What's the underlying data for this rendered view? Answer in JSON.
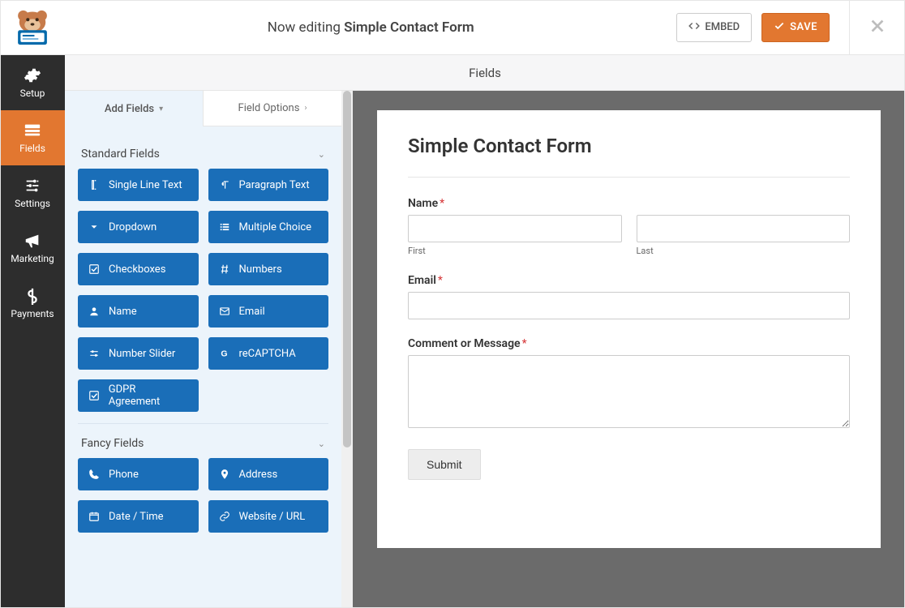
{
  "header": {
    "now_editing": "Now editing",
    "form_name": "Simple Contact Form",
    "embed": "EMBED",
    "save": "SAVE"
  },
  "sidebar": {
    "items": [
      {
        "id": "setup",
        "label": "Setup"
      },
      {
        "id": "fields",
        "label": "Fields"
      },
      {
        "id": "settings",
        "label": "Settings"
      },
      {
        "id": "marketing",
        "label": "Marketing"
      },
      {
        "id": "payments",
        "label": "Payments"
      }
    ]
  },
  "section_title": "Fields",
  "palette": {
    "tab_add": "Add Fields",
    "tab_options": "Field Options",
    "groups": [
      {
        "title": "Standard Fields",
        "fields": [
          {
            "id": "single-line-text",
            "label": "Single Line Text",
            "icon": "text-cursor"
          },
          {
            "id": "paragraph-text",
            "label": "Paragraph Text",
            "icon": "paragraph"
          },
          {
            "id": "dropdown",
            "label": "Dropdown",
            "icon": "caret-down"
          },
          {
            "id": "multiple-choice",
            "label": "Multiple Choice",
            "icon": "list"
          },
          {
            "id": "checkboxes",
            "label": "Checkboxes",
            "icon": "check-square"
          },
          {
            "id": "numbers",
            "label": "Numbers",
            "icon": "hash"
          },
          {
            "id": "name",
            "label": "Name",
            "icon": "user"
          },
          {
            "id": "email",
            "label": "Email",
            "icon": "envelope"
          },
          {
            "id": "number-slider",
            "label": "Number Slider",
            "icon": "sliders"
          },
          {
            "id": "recaptcha",
            "label": "reCAPTCHA",
            "icon": "google-g"
          },
          {
            "id": "gdpr",
            "label": "GDPR Agreement",
            "icon": "check-square"
          }
        ]
      },
      {
        "title": "Fancy Fields",
        "fields": [
          {
            "id": "phone",
            "label": "Phone",
            "icon": "phone"
          },
          {
            "id": "address",
            "label": "Address",
            "icon": "map-pin"
          },
          {
            "id": "date-time",
            "label": "Date / Time",
            "icon": "calendar"
          },
          {
            "id": "website-url",
            "label": "Website / URL",
            "icon": "link"
          }
        ]
      }
    ]
  },
  "preview": {
    "title": "Simple Contact Form",
    "name_label": "Name",
    "first_sub": "First",
    "last_sub": "Last",
    "email_label": "Email",
    "comment_label": "Comment or Message",
    "submit": "Submit",
    "required_marker": "*"
  }
}
